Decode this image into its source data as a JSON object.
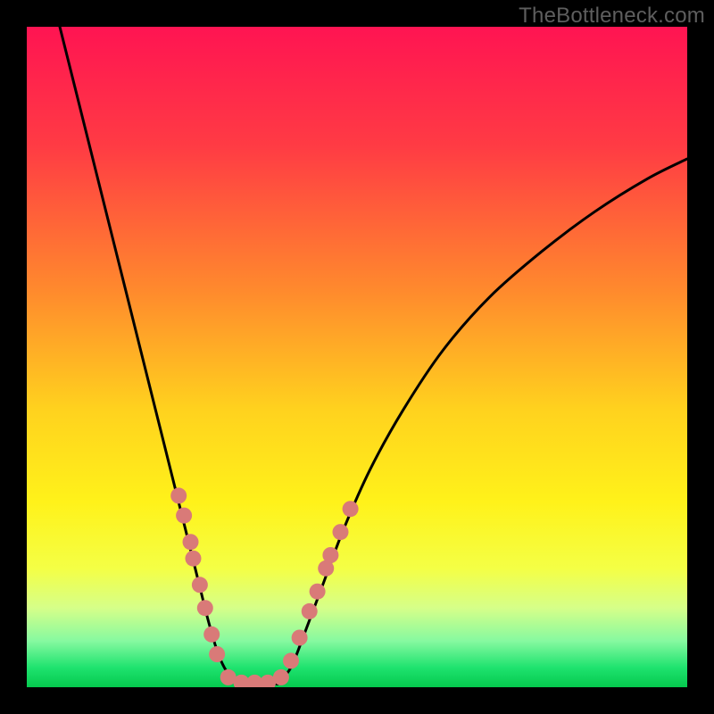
{
  "watermark": "TheBottleneck.com",
  "chart_data": {
    "type": "line",
    "title": "",
    "xlabel": "",
    "ylabel": "",
    "xlim": [
      0,
      100
    ],
    "ylim": [
      0,
      100
    ],
    "grid": false,
    "legend": false,
    "gradient_stops": [
      {
        "offset": 0,
        "color": "#ff1452"
      },
      {
        "offset": 18,
        "color": "#ff3b44"
      },
      {
        "offset": 40,
        "color": "#ff8a2d"
      },
      {
        "offset": 58,
        "color": "#ffd21e"
      },
      {
        "offset": 72,
        "color": "#fff21a"
      },
      {
        "offset": 82,
        "color": "#f4ff45"
      },
      {
        "offset": 88,
        "color": "#d6ff89"
      },
      {
        "offset": 93,
        "color": "#86f9a0"
      },
      {
        "offset": 97,
        "color": "#1fe36f"
      },
      {
        "offset": 100,
        "color": "#05c94e"
      }
    ],
    "series": [
      {
        "name": "left-curve",
        "values": [
          {
            "x": 5,
            "y": 100
          },
          {
            "x": 8,
            "y": 88
          },
          {
            "x": 11,
            "y": 76
          },
          {
            "x": 14,
            "y": 64
          },
          {
            "x": 17,
            "y": 52
          },
          {
            "x": 19.5,
            "y": 42
          },
          {
            "x": 22,
            "y": 32
          },
          {
            "x": 24,
            "y": 24
          },
          {
            "x": 26,
            "y": 16
          },
          {
            "x": 27.5,
            "y": 10
          },
          {
            "x": 29,
            "y": 5
          },
          {
            "x": 30.5,
            "y": 2
          },
          {
            "x": 32,
            "y": 0.5
          }
        ]
      },
      {
        "name": "flat-bottom",
        "values": [
          {
            "x": 32,
            "y": 0.5
          },
          {
            "x": 38,
            "y": 0.5
          }
        ]
      },
      {
        "name": "right-curve",
        "values": [
          {
            "x": 38,
            "y": 0.5
          },
          {
            "x": 40,
            "y": 3
          },
          {
            "x": 42,
            "y": 8
          },
          {
            "x": 45,
            "y": 16
          },
          {
            "x": 48,
            "y": 24
          },
          {
            "x": 52,
            "y": 33
          },
          {
            "x": 57,
            "y": 42
          },
          {
            "x": 63,
            "y": 51
          },
          {
            "x": 70,
            "y": 59
          },
          {
            "x": 78,
            "y": 66
          },
          {
            "x": 86,
            "y": 72
          },
          {
            "x": 94,
            "y": 77
          },
          {
            "x": 100,
            "y": 80
          }
        ]
      }
    ],
    "markers": [
      {
        "x": 23.0,
        "y": 29.0
      },
      {
        "x": 23.8,
        "y": 26.0
      },
      {
        "x": 24.8,
        "y": 22.0
      },
      {
        "x": 25.2,
        "y": 19.5
      },
      {
        "x": 26.2,
        "y": 15.5
      },
      {
        "x": 27.0,
        "y": 12.0
      },
      {
        "x": 28.0,
        "y": 8.0
      },
      {
        "x": 28.8,
        "y": 5.0
      },
      {
        "x": 30.5,
        "y": 1.5
      },
      {
        "x": 32.5,
        "y": 0.7
      },
      {
        "x": 34.5,
        "y": 0.7
      },
      {
        "x": 36.5,
        "y": 0.7
      },
      {
        "x": 38.5,
        "y": 1.5
      },
      {
        "x": 40.0,
        "y": 4.0
      },
      {
        "x": 41.3,
        "y": 7.5
      },
      {
        "x": 42.8,
        "y": 11.5
      },
      {
        "x": 44.0,
        "y": 14.5
      },
      {
        "x": 45.3,
        "y": 18.0
      },
      {
        "x": 46.0,
        "y": 20.0
      },
      {
        "x": 47.5,
        "y": 23.5
      },
      {
        "x": 49.0,
        "y": 27.0
      }
    ],
    "marker_style": {
      "radius": 9,
      "fill": "#d97a78"
    }
  }
}
